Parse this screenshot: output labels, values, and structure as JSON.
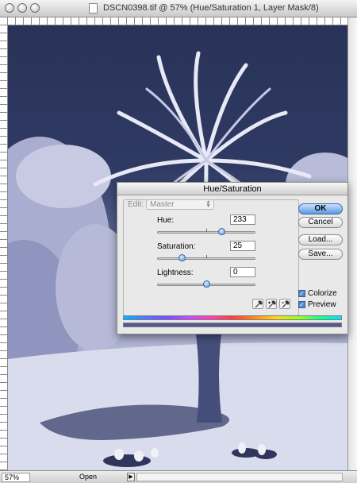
{
  "window": {
    "title": "DSCN0398.tif @ 57% (Hue/Saturation 1, Layer Mask/8)"
  },
  "statusbar": {
    "zoom": "57%",
    "doc_info": "Open"
  },
  "dialog": {
    "title": "Hue/Saturation",
    "edit_label": "Edit:",
    "edit_value": "Master",
    "hue": {
      "label": "Hue:",
      "value": "233",
      "slider_fraction": 0.65
    },
    "saturation": {
      "label": "Saturation:",
      "value": "25",
      "slider_fraction": 0.25
    },
    "lightness": {
      "label": "Lightness:",
      "value": "0",
      "slider_fraction": 0.5
    },
    "buttons": {
      "ok": "OK",
      "cancel": "Cancel",
      "load": "Load...",
      "save": "Save..."
    },
    "colorize": {
      "label": "Colorize",
      "checked": true
    },
    "preview": {
      "label": "Preview",
      "checked": true
    },
    "result_color": "#525a8f"
  },
  "colors": {
    "sky": "#293359",
    "lawn": "#dfe1ee",
    "accent": "#5d98de"
  },
  "icons": [
    "close-icon",
    "minimize-icon",
    "zoom-icon",
    "document-icon",
    "eyedropper-icon",
    "eyedropper-plus-icon",
    "eyedropper-minus-icon",
    "check-icon"
  ]
}
